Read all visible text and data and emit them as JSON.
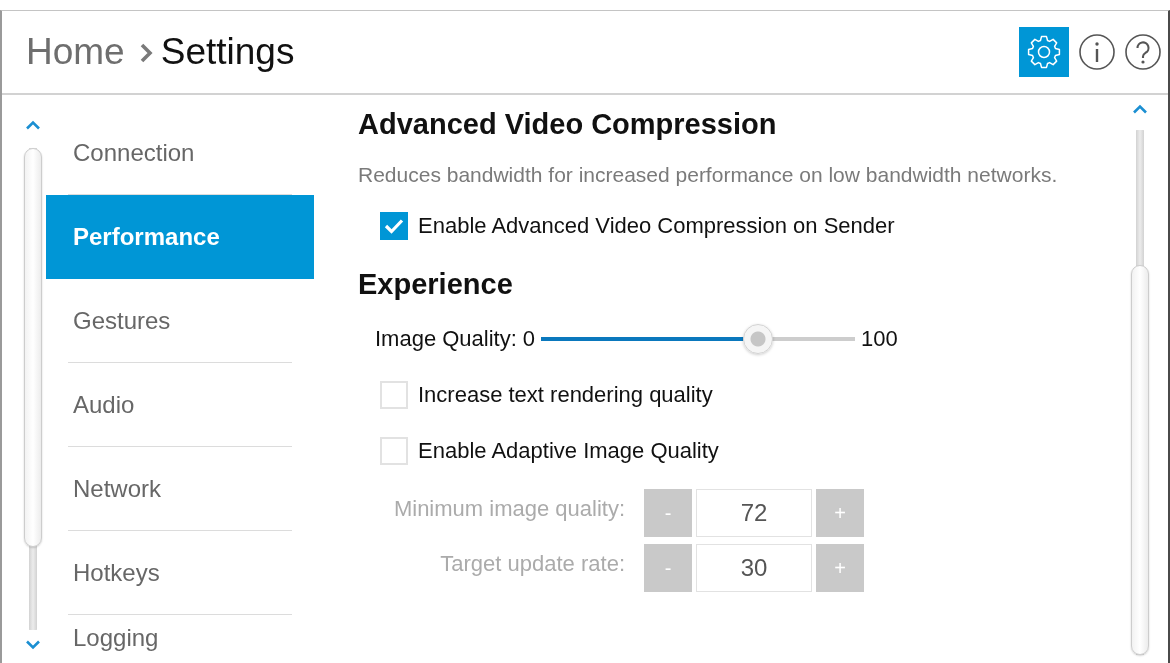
{
  "header": {
    "breadcrumb": [
      {
        "label": "Home",
        "current": false
      },
      {
        "label": "Settings",
        "current": true
      }
    ],
    "buttons": [
      {
        "kind": "settings",
        "selected": true
      },
      {
        "kind": "info",
        "selected": false
      },
      {
        "kind": "help",
        "selected": false
      }
    ]
  },
  "sidebar": {
    "items": [
      {
        "label": "Connection",
        "selected": false
      },
      {
        "label": "Performance",
        "selected": true
      },
      {
        "label": "Gestures",
        "selected": false
      },
      {
        "label": "Audio",
        "selected": false
      },
      {
        "label": "Network",
        "selected": false
      },
      {
        "label": "Hotkeys",
        "selected": false
      },
      {
        "label": "Logging",
        "selected": false
      }
    ]
  },
  "content": {
    "sections": [
      {
        "title": "Advanced Video Compression",
        "description": "Reduces bandwidth for increased performance on low bandwidth networks.",
        "controls": [
          {
            "kind": "checkbox",
            "label": "Enable Advanced Video Compression on Sender",
            "checked": true
          }
        ]
      },
      {
        "title": "Experience",
        "controls": [
          {
            "kind": "slider",
            "label": "Image Quality:",
            "min_label": "0",
            "max_label": "100",
            "level": 0.69
          },
          {
            "kind": "checkbox",
            "label": "Increase text rendering quality",
            "checked": false
          },
          {
            "kind": "checkbox",
            "label": "Enable Adaptive Image Quality",
            "checked": false
          },
          {
            "kind": "spinner",
            "label": "Minimum image quality:",
            "value": "72",
            "decrement_label": "-",
            "increment_label": "+",
            "disabled": true
          },
          {
            "kind": "spinner",
            "label": "Target update rate:",
            "value": "30",
            "decrement_label": "-",
            "increment_label": "+",
            "disabled": true
          }
        ]
      }
    ]
  }
}
